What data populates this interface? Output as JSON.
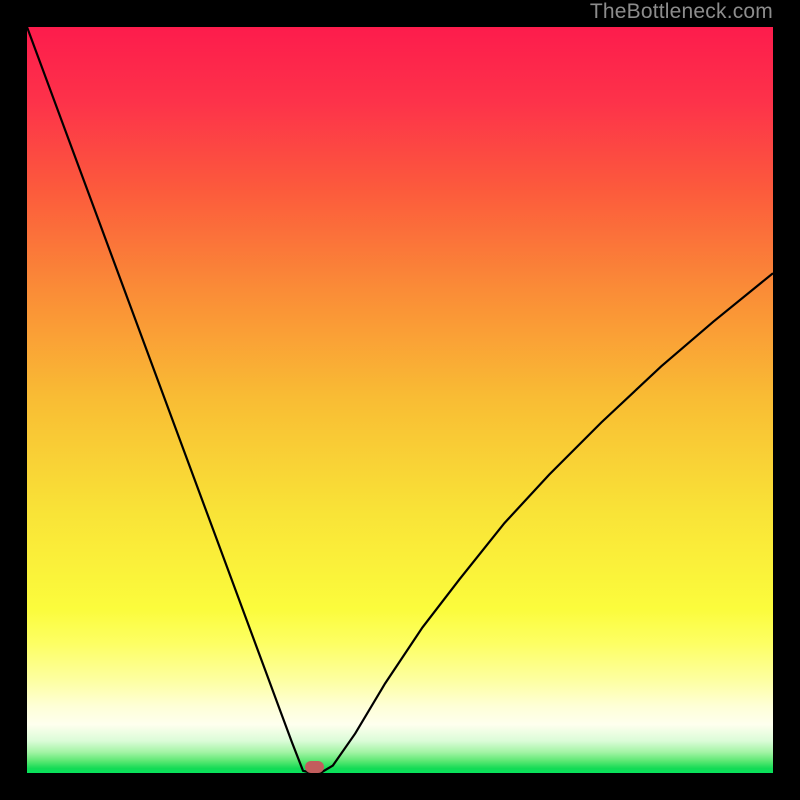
{
  "watermark": "TheBottleneck.com",
  "chart_data": {
    "type": "line",
    "title": "",
    "xlabel": "",
    "ylabel": "",
    "xlim": [
      0,
      100
    ],
    "ylim": [
      0,
      100
    ],
    "curve": {
      "x": [
        0,
        5,
        10,
        15,
        20,
        25,
        30,
        32,
        34,
        35.5,
        37,
        37.8,
        38.3,
        39.5,
        41,
        44,
        48,
        53,
        58,
        64,
        70,
        77,
        85,
        92,
        100
      ],
      "y": [
        100,
        86.5,
        73,
        59.5,
        46,
        32.5,
        19,
        13.6,
        8.2,
        4.15,
        0.3,
        0.1,
        0.1,
        0.1,
        1.0,
        5.3,
        12,
        19.5,
        26,
        33.5,
        40,
        47,
        54.5,
        60.5,
        67
      ]
    },
    "gradient_stops": [
      {
        "offset": 0.0,
        "color": "#fd1c4c"
      },
      {
        "offset": 0.1,
        "color": "#fd324a"
      },
      {
        "offset": 0.22,
        "color": "#fc5b3c"
      },
      {
        "offset": 0.35,
        "color": "#fa8b37"
      },
      {
        "offset": 0.5,
        "color": "#f9bd34"
      },
      {
        "offset": 0.65,
        "color": "#f9e337"
      },
      {
        "offset": 0.78,
        "color": "#fbfc3c"
      },
      {
        "offset": 0.826,
        "color": "#fdff63"
      },
      {
        "offset": 0.875,
        "color": "#fdffa0"
      },
      {
        "offset": 0.91,
        "color": "#feffd6"
      },
      {
        "offset": 0.935,
        "color": "#feffee"
      },
      {
        "offset": 0.957,
        "color": "#dbfcd8"
      },
      {
        "offset": 0.972,
        "color": "#a3f4a5"
      },
      {
        "offset": 0.984,
        "color": "#5be873"
      },
      {
        "offset": 0.994,
        "color": "#13db55"
      },
      {
        "offset": 1.0,
        "color": "#07e45d"
      }
    ],
    "marker": {
      "x": 38.6,
      "y": 0.8,
      "color": "#c25d5d"
    }
  }
}
